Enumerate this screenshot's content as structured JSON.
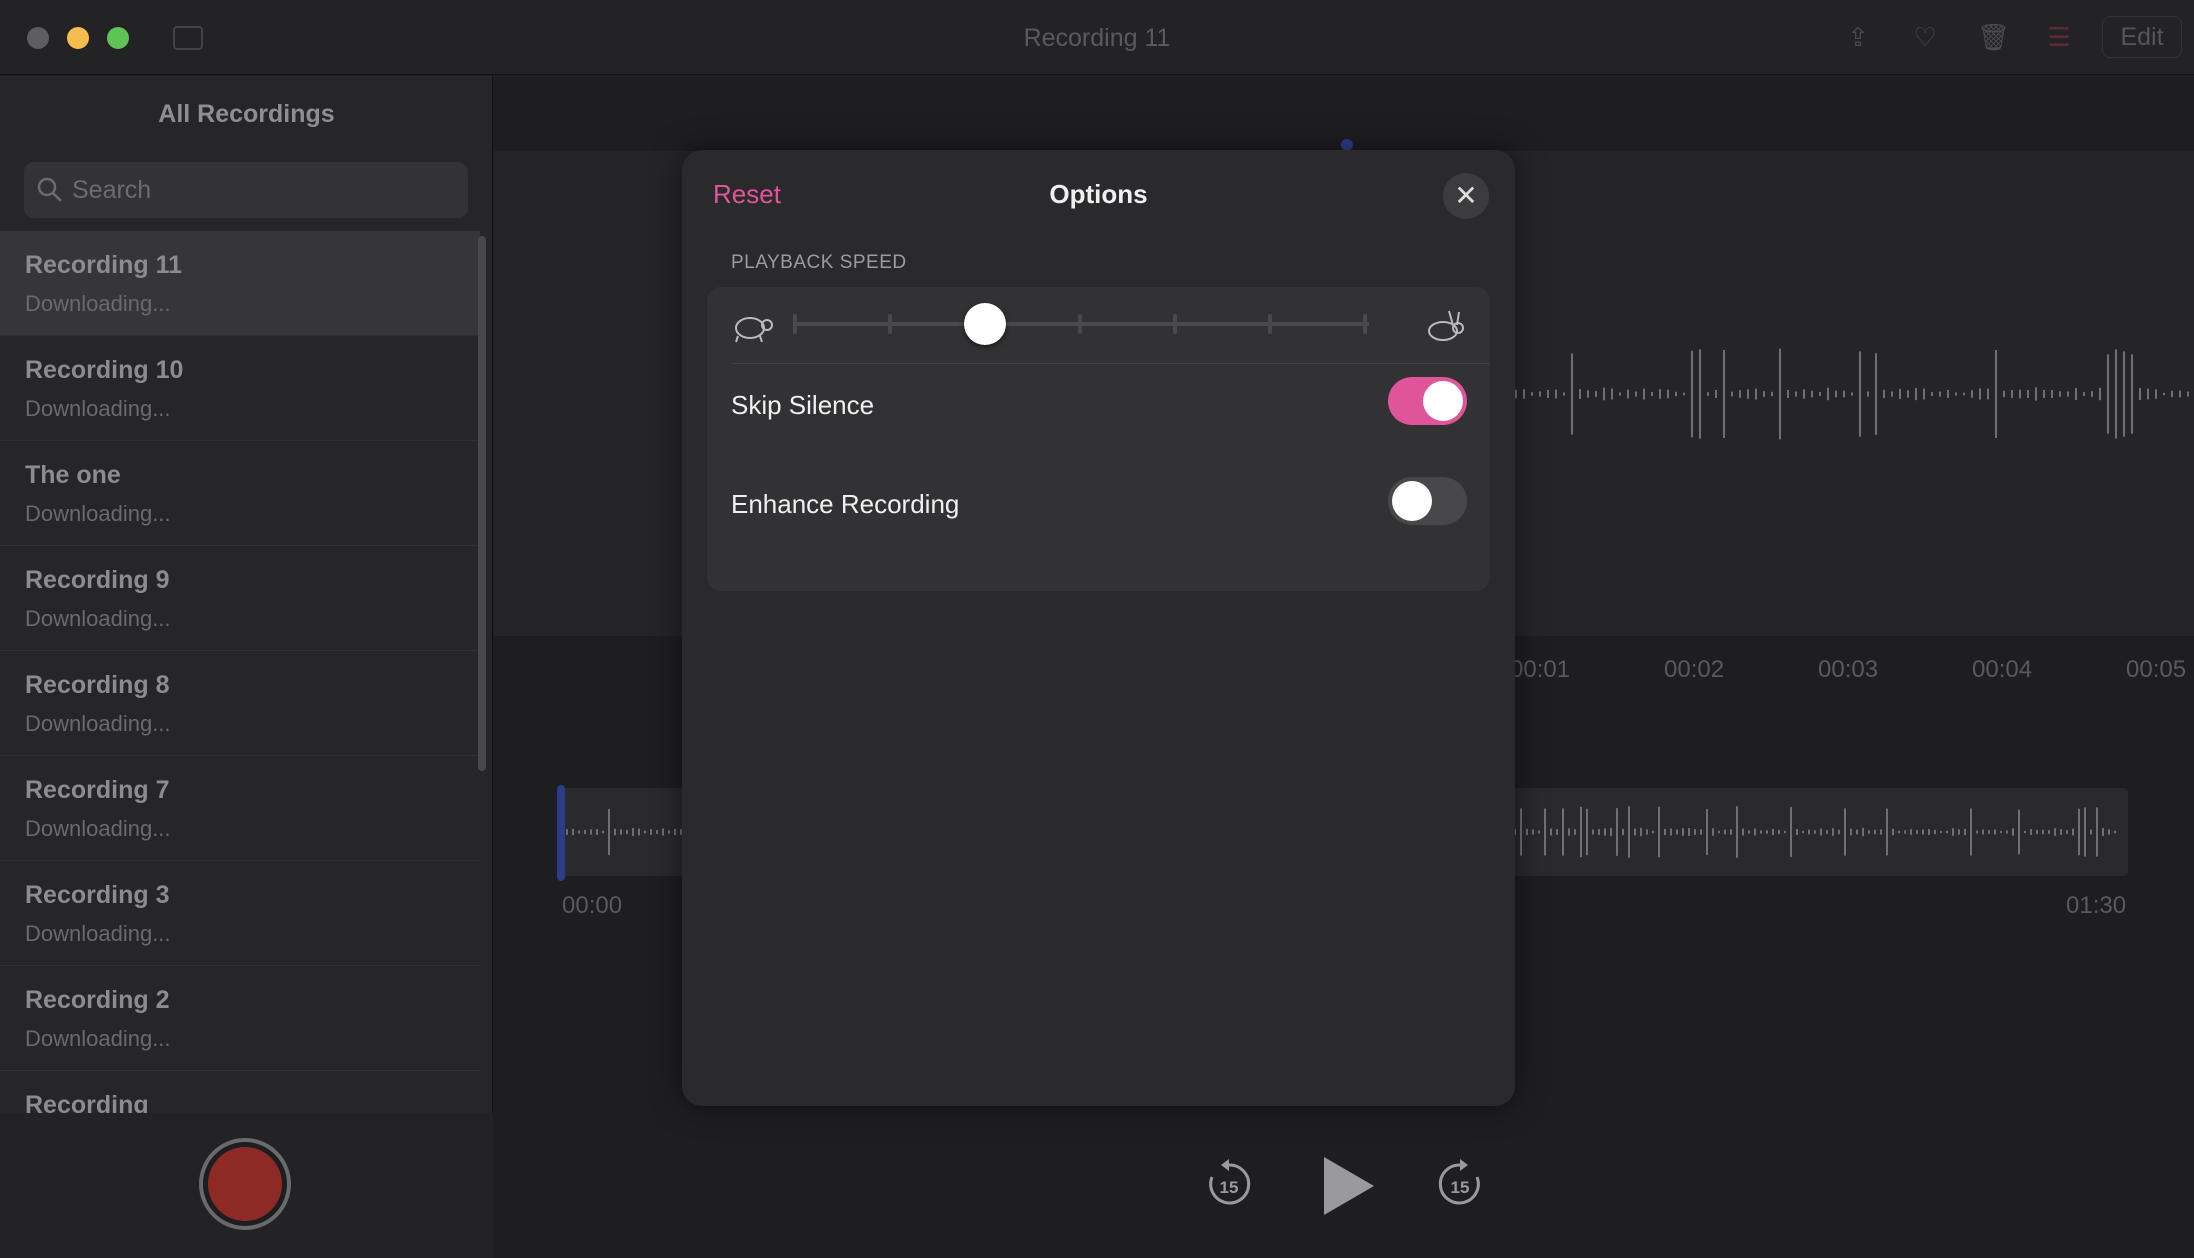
{
  "window": {
    "title": "Recording 11",
    "edit_label": "Edit",
    "icons": [
      "share-icon",
      "heart-icon",
      "trash-icon",
      "options-icon"
    ]
  },
  "colors": {
    "accent": "#e0559a",
    "record": "#8e2a26",
    "playhead": "#2b3d8a"
  },
  "sidebar": {
    "title": "All Recordings",
    "search_placeholder": "Search",
    "items": [
      {
        "name": "Recording 11",
        "status": "Downloading..."
      },
      {
        "name": "Recording 10",
        "status": "Downloading..."
      },
      {
        "name": "The one",
        "status": "Downloading..."
      },
      {
        "name": "Recording 9",
        "status": "Downloading..."
      },
      {
        "name": "Recording 8",
        "status": "Downloading..."
      },
      {
        "name": "Recording 7",
        "status": "Downloading..."
      },
      {
        "name": "Recording 3",
        "status": "Downloading..."
      },
      {
        "name": "Recording 2",
        "status": "Downloading..."
      },
      {
        "name": "Recording",
        "status": ""
      }
    ]
  },
  "timeline": {
    "labels": [
      "00:01",
      "00:02",
      "00:03",
      "00:04",
      "00:05"
    ],
    "start": "00:00",
    "end": "01:30"
  },
  "player": {
    "skip_back": "15",
    "skip_forward": "15"
  },
  "options": {
    "reset_label": "Reset",
    "title": "Options",
    "playback_speed_label": "PLAYBACK SPEED",
    "speed_step": 2,
    "speed_steps": 7,
    "skip_silence_label": "Skip Silence",
    "skip_silence_on": true,
    "enhance_label": "Enhance Recording",
    "enhance_on": false
  }
}
